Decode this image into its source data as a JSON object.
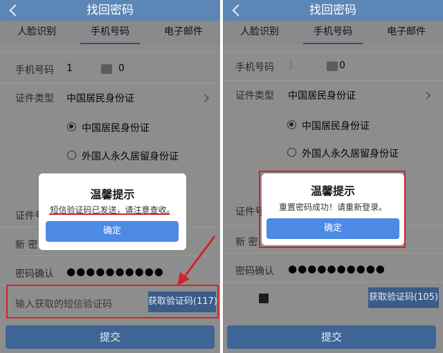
{
  "left": {
    "header": {
      "title": "找回密码"
    },
    "tabs": [
      "人脸识别",
      "手机号码",
      "电子邮件"
    ],
    "form": {
      "phone_label": "手机号码",
      "phone_value_start": "1",
      "phone_value_end": "0",
      "id_type_label": "证件类型",
      "id_type_value": "中国居民身份证",
      "radio_options": [
        "中国居民身份证",
        "外国人永久居留身份证"
      ],
      "id_number_label": "证件号",
      "new_password_label": "新 密",
      "confirm_label": "密码确认",
      "password_mask": "●●●●●●●●●●",
      "sms_placeholder": "输入获取的短信验证码",
      "get_code_label": "获取验证码(117)"
    },
    "submit_label": "提交",
    "modal": {
      "title": "温馨提示",
      "message": "短信验证码已发送，请注意查收。",
      "confirm_label": "确定"
    }
  },
  "right": {
    "header": {
      "title": "找回密码"
    },
    "tabs": [
      "人脸识别",
      "手机号码",
      "电子邮件"
    ],
    "form": {
      "phone_label": "手机号码",
      "phone_value_start": "1",
      "phone_value_end": "0",
      "id_type_label": "证件类型",
      "id_type_value": "中国居民身份证",
      "radio_options": [
        "中国居民身份证",
        "外国人永久居留身份证"
      ],
      "id_number_label": "证件号",
      "new_password_label": "新 密",
      "confirm_label": "密码确认",
      "password_mask": "●●●●●●●●●●",
      "get_code_label": "获取验证码(105)"
    },
    "submit_label": "提交",
    "modal": {
      "title": "温馨提示",
      "message": "重置密码成功！请重新登录。",
      "confirm_label": "确定"
    }
  },
  "colors": {
    "header_blue": "#5b86b6",
    "button_blue": "#4c8ae6",
    "annotation_red": "#d0242a"
  }
}
